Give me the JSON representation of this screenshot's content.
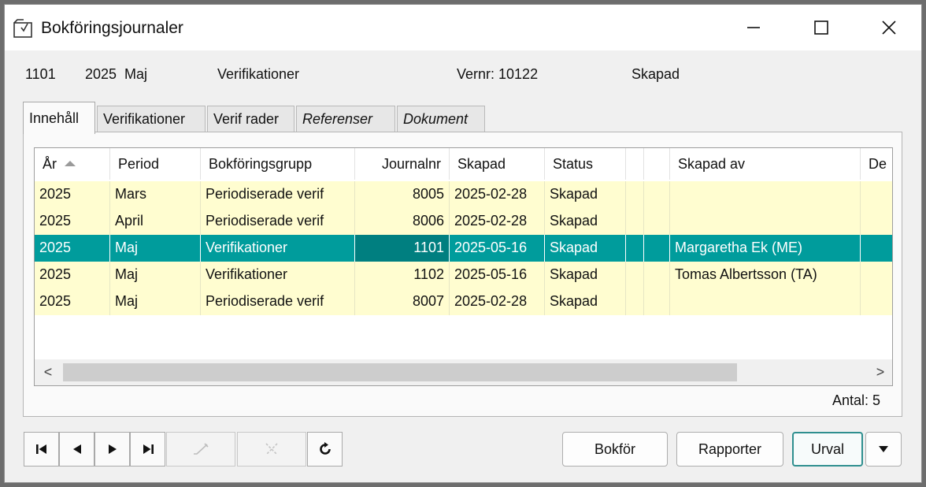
{
  "window": {
    "title": "Bokföringsjournaler",
    "app_icon": "journal-export-icon",
    "controls": {
      "minimize": "minimize-icon",
      "maximize": "maximize-icon",
      "close": "close-icon"
    }
  },
  "info": {
    "journalnr": "1101",
    "year_period": "2025  Maj",
    "group": "Verifikationer",
    "vernr": "Vernr: 10122",
    "status": "Skapad"
  },
  "tabs": [
    {
      "label": "Innehåll",
      "active": true,
      "italic": false
    },
    {
      "label": "Verifikationer",
      "active": false,
      "italic": false
    },
    {
      "label": "Verif rader",
      "active": false,
      "italic": false
    },
    {
      "label": "Referenser",
      "active": false,
      "italic": true
    },
    {
      "label": "Dokument",
      "active": false,
      "italic": true
    }
  ],
  "grid": {
    "columns": [
      "År",
      "Period",
      "Bokföringsgrupp",
      "Journalnr",
      "Skapad",
      "Status",
      "",
      "",
      "Skapad av",
      "De"
    ],
    "sort_column": "År",
    "rows": [
      {
        "ar": "2025",
        "period": "Mars",
        "grupp": "Periodiserade verif",
        "journalnr": "8005",
        "skapad": "2025-02-28",
        "status": "Skapad",
        "skapad_av": ""
      },
      {
        "ar": "2025",
        "period": "April",
        "grupp": "Periodiserade verif",
        "journalnr": "8006",
        "skapad": "2025-02-28",
        "status": "Skapad",
        "skapad_av": ""
      },
      {
        "ar": "2025",
        "period": "Maj",
        "grupp": "Verifikationer",
        "journalnr": "1101",
        "skapad": "2025-05-16",
        "status": "Skapad",
        "skapad_av": "Margaretha Ek (ME)",
        "selected": true
      },
      {
        "ar": "2025",
        "period": "Maj",
        "grupp": "Verifikationer",
        "journalnr": "1102",
        "skapad": "2025-05-16",
        "status": "Skapad",
        "skapad_av": "Tomas Albertsson (TA)"
      },
      {
        "ar": "2025",
        "period": "Maj",
        "grupp": "Periodiserade verif",
        "journalnr": "8007",
        "skapad": "2025-02-28",
        "status": "Skapad",
        "skapad_av": ""
      }
    ],
    "scroll_left": "<",
    "scroll_right": ">"
  },
  "count": "Antal: 5",
  "toolbar": {
    "first": "first-record-icon",
    "prev": "previous-record-icon",
    "next": "next-record-icon",
    "last": "last-record-icon",
    "edit": "edit-icon",
    "delete": "delete-icon",
    "refresh": "refresh-icon",
    "bokfor": "Bokför",
    "rapporter": "Rapporter",
    "urval": "Urval",
    "dropdown": "dropdown-arrow-icon"
  },
  "colors": {
    "row_bg": "#fffdd0",
    "selected_bg": "#009c9c",
    "selected_focus_bg": "#007f80",
    "accent_border": "#2f8f8f"
  }
}
